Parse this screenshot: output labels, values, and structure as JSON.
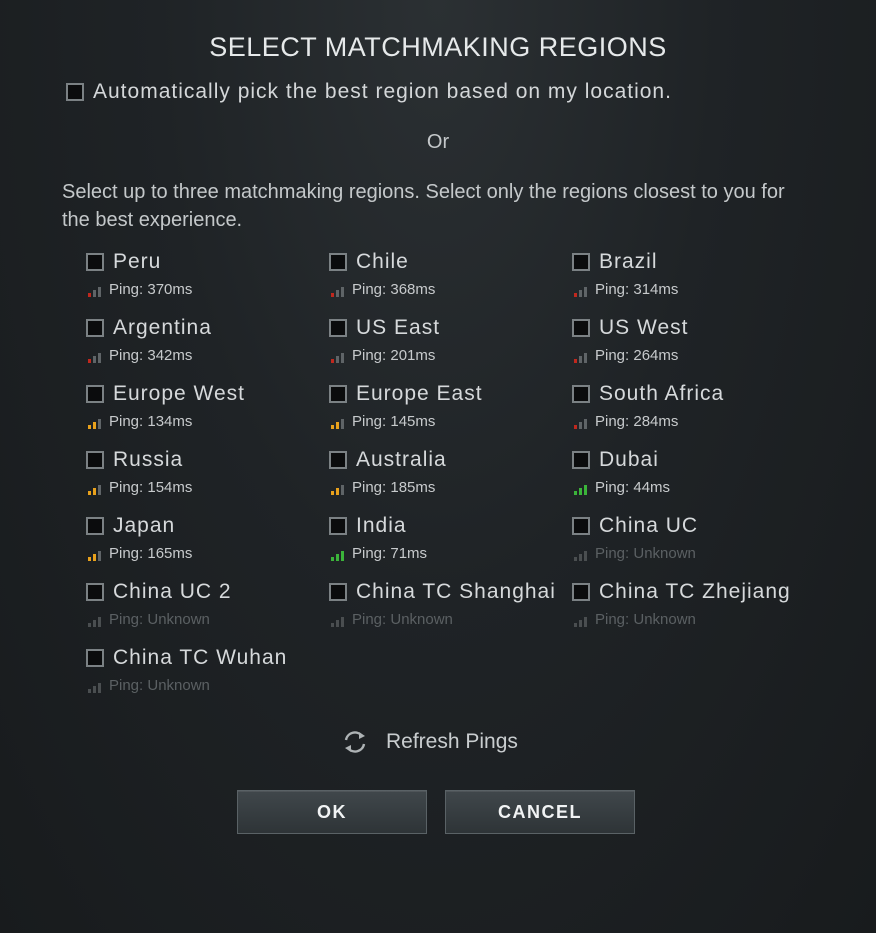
{
  "dialog": {
    "title": "SELECT MATCHMAKING REGIONS",
    "auto_label": "Automatically pick the best region based on my location.",
    "or_label": "Or",
    "instructions": "Select up to three matchmaking regions. Select only the regions closest to you for the best experience."
  },
  "ping_colors": {
    "bad": "#c0281e",
    "medium": "#e8a11c",
    "good": "#3bb43a",
    "unknown": "#4a4e50",
    "inactive": "#5f6467"
  },
  "regions": [
    {
      "name": "Peru",
      "ping": "Ping: 370ms",
      "quality": "bad"
    },
    {
      "name": "Chile",
      "ping": "Ping: 368ms",
      "quality": "bad"
    },
    {
      "name": "Brazil",
      "ping": "Ping: 314ms",
      "quality": "bad"
    },
    {
      "name": "Argentina",
      "ping": "Ping: 342ms",
      "quality": "bad"
    },
    {
      "name": "US East",
      "ping": "Ping: 201ms",
      "quality": "bad"
    },
    {
      "name": "US West",
      "ping": "Ping: 264ms",
      "quality": "bad"
    },
    {
      "name": "Europe West",
      "ping": "Ping: 134ms",
      "quality": "medium"
    },
    {
      "name": "Europe East",
      "ping": "Ping: 145ms",
      "quality": "medium"
    },
    {
      "name": "South Africa",
      "ping": "Ping: 284ms",
      "quality": "bad"
    },
    {
      "name": "Russia",
      "ping": "Ping: 154ms",
      "quality": "medium"
    },
    {
      "name": "Australia",
      "ping": "Ping: 185ms",
      "quality": "medium"
    },
    {
      "name": "Dubai",
      "ping": "Ping: 44ms",
      "quality": "good"
    },
    {
      "name": "Japan",
      "ping": "Ping: 165ms",
      "quality": "medium"
    },
    {
      "name": "India",
      "ping": "Ping: 71ms",
      "quality": "good"
    },
    {
      "name": "China UC",
      "ping": "Ping: Unknown",
      "quality": "unknown"
    },
    {
      "name": "China UC 2",
      "ping": "Ping: Unknown",
      "quality": "unknown"
    },
    {
      "name": "China TC Shanghai",
      "ping": "Ping: Unknown",
      "quality": "unknown"
    },
    {
      "name": "China TC Zhejiang",
      "ping": "Ping: Unknown",
      "quality": "unknown"
    },
    {
      "name": "China TC Wuhan",
      "ping": "Ping: Unknown",
      "quality": "unknown"
    }
  ],
  "actions": {
    "refresh_label": "Refresh Pings",
    "refresh_icon": "refresh-icon",
    "ok_label": "OK",
    "cancel_label": "CANCEL"
  }
}
